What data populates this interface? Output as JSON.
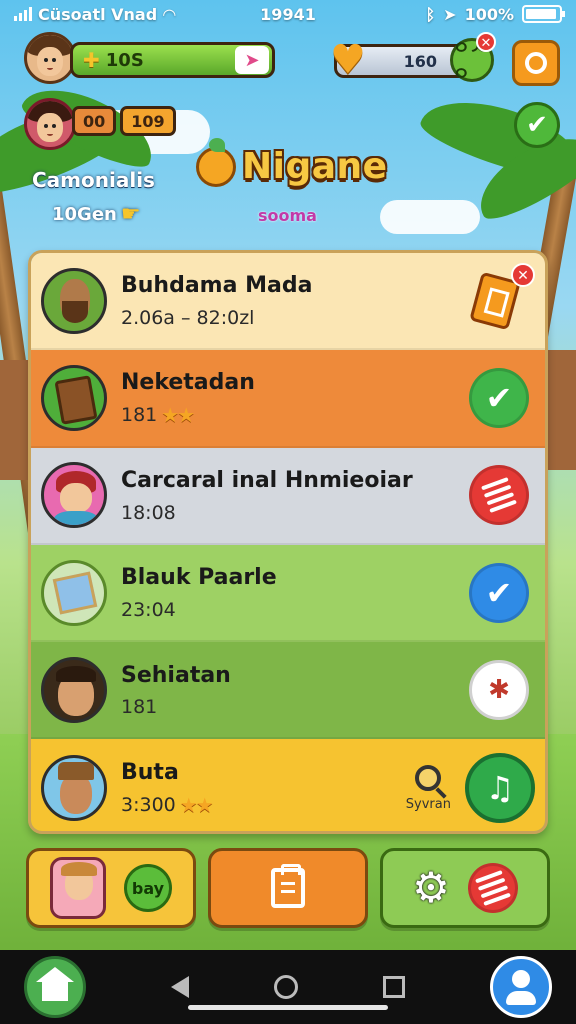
{
  "status_bar": {
    "carrier": "Cüsoatl Vnad",
    "time": "19941",
    "battery": "100%"
  },
  "hud": {
    "xp_value": "10S",
    "chip_a": "00",
    "chip_b": "109",
    "heart_value": "160",
    "player_name": "Camonialis",
    "player_sub": "10Gen"
  },
  "logo": {
    "title": "Nigane",
    "subtitle": "sooma"
  },
  "list": [
    {
      "name": "Buhdama Mada",
      "sub": "2.06a – 82:0zl",
      "action": "card-icon",
      "bg": "#fbe6b4"
    },
    {
      "name": "Neketadan",
      "sub": "181",
      "stars": "★★",
      "action": "check-icon",
      "bg": "#ee8a3a"
    },
    {
      "name": "Carcaral inal Hnmieoiar",
      "sub": "18:08",
      "action": "stripes-icon",
      "bg": "#d4d8de"
    },
    {
      "name": "Blauk Paarle",
      "sub": "23:04",
      "action": "check-icon",
      "bg": "#9ed164"
    },
    {
      "name": "Sehiatan",
      "sub": "181",
      "action": "compass-icon",
      "bg": "#7fb648"
    },
    {
      "name": "Buta",
      "sub": "3:300",
      "stars": "★★",
      "search_label": "Syvran",
      "action": "music-note-icon",
      "bg": "#f6c330"
    }
  ],
  "bottom": {
    "bottle_label": "bay"
  },
  "icons": {
    "plus": "✚",
    "heart": "♥",
    "check": "✔",
    "music": "♫",
    "gear": "⚙",
    "close": "✕",
    "hand": "☛",
    "arrow": "➤"
  }
}
